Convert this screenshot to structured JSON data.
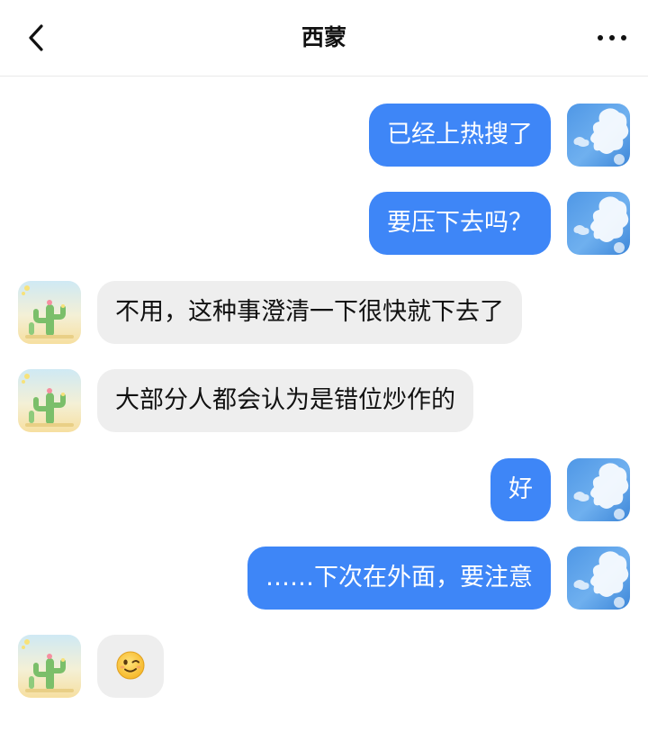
{
  "header": {
    "title": "西蒙"
  },
  "messages": [
    {
      "from": "me",
      "text": "已经上热搜了"
    },
    {
      "from": "me",
      "text": "要压下去吗？"
    },
    {
      "from": "them",
      "text": "不用，这种事澄清一下很快就下去了"
    },
    {
      "from": "them",
      "text": "大部分人都会认为是错位炒作的"
    },
    {
      "from": "me",
      "text": "好"
    },
    {
      "from": "me",
      "text": "……下次在外面，要注意"
    },
    {
      "from": "them",
      "emoji": "wink-face-icon"
    }
  ],
  "colors": {
    "my_bubble": "#3e86f7",
    "their_bubble": "#eeeeee",
    "header_bg": "#ffffff"
  },
  "icons": {
    "back": "chevron-left-icon",
    "more": "more-dots-icon",
    "my_avatar": "sky-clouds-avatar",
    "their_avatar": "cactus-avatar"
  }
}
